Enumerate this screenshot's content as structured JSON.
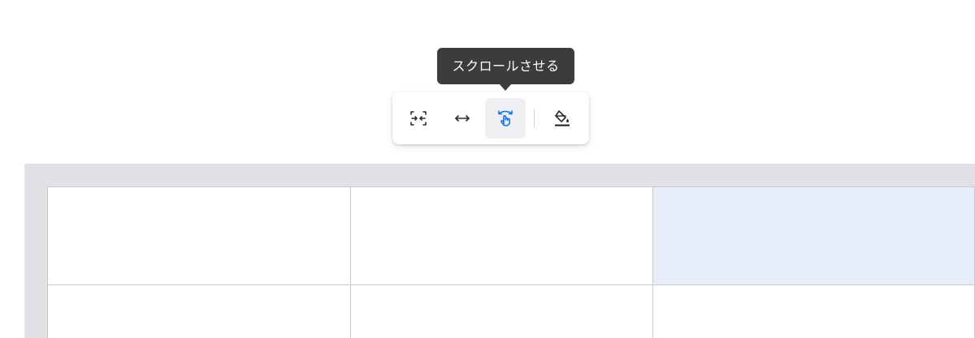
{
  "tooltip": {
    "text": "スクロールさせる"
  },
  "toolbar": {
    "buttons": [
      {
        "icon": "fit-to-page-icon"
      },
      {
        "icon": "full-width-icon"
      },
      {
        "icon": "scroll-gesture-icon",
        "active": true
      },
      {
        "icon": "fill-color-icon"
      }
    ],
    "accent_color": "#1a73e8"
  },
  "table": {
    "rows": 2,
    "columns": 3,
    "selected_cell": {
      "row": 0,
      "column": 2
    }
  },
  "colors": {
    "tooltip_bg": "#3c3c3c",
    "table_frame_bg": "#e2e2e6",
    "selected_cell_bg": "#e6edf8",
    "grid_line": "#c9c9c9"
  }
}
